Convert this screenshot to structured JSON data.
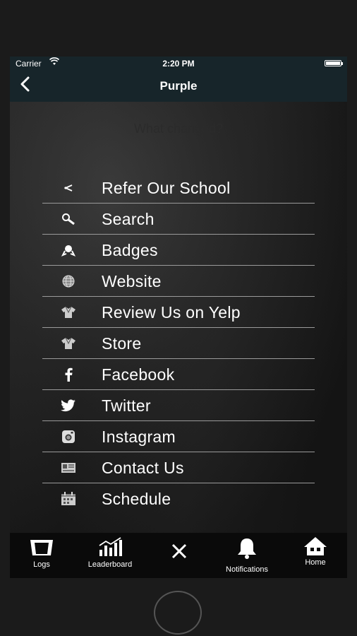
{
  "status_bar": {
    "carrier": "Carrier",
    "time": "2:20 PM"
  },
  "nav": {
    "title": "Purple"
  },
  "background_text": "What changed?",
  "menu": [
    {
      "label": "Refer Our School",
      "icon": "share-icon"
    },
    {
      "label": "Search",
      "icon": "search-icon"
    },
    {
      "label": "Badges",
      "icon": "badge-icon"
    },
    {
      "label": "Website",
      "icon": "globe-icon"
    },
    {
      "label": "Review Us on Yelp",
      "icon": "gi-icon"
    },
    {
      "label": "Store",
      "icon": "gi-icon"
    },
    {
      "label": "Facebook",
      "icon": "facebook-icon"
    },
    {
      "label": "Twitter",
      "icon": "twitter-icon"
    },
    {
      "label": "Instagram",
      "icon": "instagram-icon"
    },
    {
      "label": "Contact Us",
      "icon": "contact-card-icon"
    },
    {
      "label": "Schedule",
      "icon": "calendar-icon"
    }
  ],
  "tabs": [
    {
      "label": "Logs",
      "icon": "logs-icon"
    },
    {
      "label": "Leaderboard",
      "icon": "chart-icon"
    },
    {
      "label": "",
      "icon": "close-icon"
    },
    {
      "label": "Notifications",
      "icon": "bell-icon"
    },
    {
      "label": "Home",
      "icon": "home-icon"
    }
  ],
  "colors": {
    "nav_bg": "#17252a",
    "tab_bg": "#0a0a0a",
    "divider": "#9a9a9a",
    "text": "#ffffff"
  }
}
